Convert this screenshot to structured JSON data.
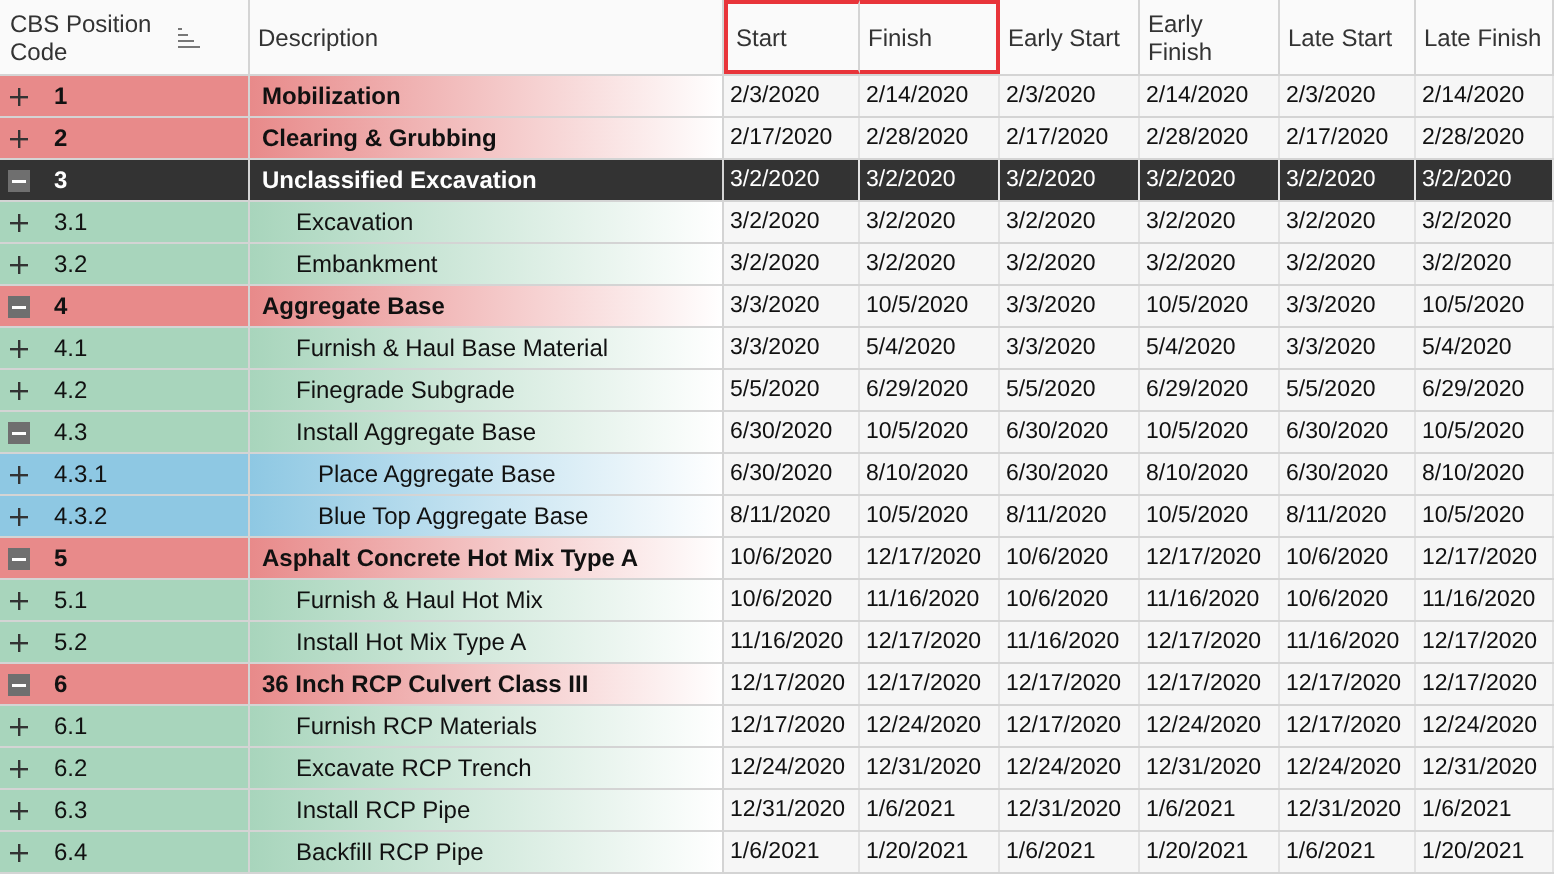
{
  "columns": [
    {
      "label": "CBS Position Code",
      "highlighted": false
    },
    {
      "label": "Description",
      "highlighted": false
    },
    {
      "label": "Start",
      "highlighted": true
    },
    {
      "label": "Finish",
      "highlighted": true
    },
    {
      "label": "Early Start",
      "highlighted": false
    },
    {
      "label": "Early Finish",
      "highlighted": false
    },
    {
      "label": "Late Start",
      "highlighted": false
    },
    {
      "label": "Late Finish",
      "highlighted": false
    }
  ],
  "rows": [
    {
      "code": "1",
      "description": "Mobilization",
      "expanded": false,
      "selected": false,
      "dates": [
        "2/3/2020",
        "2/14/2020",
        "2/3/2020",
        "2/14/2020",
        "2/3/2020",
        "2/14/2020"
      ]
    },
    {
      "code": "2",
      "description": "Clearing & Grubbing",
      "expanded": false,
      "selected": false,
      "dates": [
        "2/17/2020",
        "2/28/2020",
        "2/17/2020",
        "2/28/2020",
        "2/17/2020",
        "2/28/2020"
      ]
    },
    {
      "code": "3",
      "description": "Unclassified Excavation",
      "expanded": true,
      "selected": true,
      "dates": [
        "3/2/2020",
        "3/2/2020",
        "3/2/2020",
        "3/2/2020",
        "3/2/2020",
        "3/2/2020"
      ],
      "children": [
        {
          "code": "3.1",
          "description": "Excavation",
          "expanded": false,
          "selected": false,
          "dates": [
            "3/2/2020",
            "3/2/2020",
            "3/2/2020",
            "3/2/2020",
            "3/2/2020",
            "3/2/2020"
          ]
        },
        {
          "code": "3.2",
          "description": "Embankment",
          "expanded": false,
          "selected": false,
          "dates": [
            "3/2/2020",
            "3/2/2020",
            "3/2/2020",
            "3/2/2020",
            "3/2/2020",
            "3/2/2020"
          ]
        }
      ]
    },
    {
      "code": "4",
      "description": "Aggregate Base",
      "expanded": true,
      "selected": false,
      "dates": [
        "3/3/2020",
        "10/5/2020",
        "3/3/2020",
        "10/5/2020",
        "3/3/2020",
        "10/5/2020"
      ],
      "children": [
        {
          "code": "4.1",
          "description": "Furnish & Haul Base Material",
          "expanded": false,
          "selected": false,
          "dates": [
            "3/3/2020",
            "5/4/2020",
            "3/3/2020",
            "5/4/2020",
            "3/3/2020",
            "5/4/2020"
          ]
        },
        {
          "code": "4.2",
          "description": "Finegrade Subgrade",
          "expanded": false,
          "selected": false,
          "dates": [
            "5/5/2020",
            "6/29/2020",
            "5/5/2020",
            "6/29/2020",
            "5/5/2020",
            "6/29/2020"
          ]
        },
        {
          "code": "4.3",
          "description": "Install Aggregate Base",
          "expanded": true,
          "selected": false,
          "dates": [
            "6/30/2020",
            "10/5/2020",
            "6/30/2020",
            "10/5/2020",
            "6/30/2020",
            "10/5/2020"
          ],
          "children": [
            {
              "code": "4.3.1",
              "description": "Place Aggregate Base",
              "expanded": false,
              "selected": false,
              "dates": [
                "6/30/2020",
                "8/10/2020",
                "6/30/2020",
                "8/10/2020",
                "6/30/2020",
                "8/10/2020"
              ]
            },
            {
              "code": "4.3.2",
              "description": "Blue Top Aggregate Base",
              "expanded": false,
              "selected": false,
              "dates": [
                "8/11/2020",
                "10/5/2020",
                "8/11/2020",
                "10/5/2020",
                "8/11/2020",
                "10/5/2020"
              ]
            }
          ]
        }
      ]
    },
    {
      "code": "5",
      "description": "Asphalt Concrete Hot Mix Type A",
      "expanded": true,
      "selected": false,
      "dates": [
        "10/6/2020",
        "12/17/2020",
        "10/6/2020",
        "12/17/2020",
        "10/6/2020",
        "12/17/2020"
      ],
      "children": [
        {
          "code": "5.1",
          "description": "Furnish & Haul Hot Mix",
          "expanded": false,
          "selected": false,
          "dates": [
            "10/6/2020",
            "11/16/2020",
            "10/6/2020",
            "11/16/2020",
            "10/6/2020",
            "11/16/2020"
          ]
        },
        {
          "code": "5.2",
          "description": "Install Hot Mix Type A",
          "expanded": false,
          "selected": false,
          "dates": [
            "11/16/2020",
            "12/17/2020",
            "11/16/2020",
            "12/17/2020",
            "11/16/2020",
            "12/17/2020"
          ]
        }
      ]
    },
    {
      "code": "6",
      "description": "36 Inch RCP Culvert Class III",
      "expanded": true,
      "selected": false,
      "dates": [
        "12/17/2020",
        "12/17/2020",
        "12/17/2020",
        "12/17/2020",
        "12/17/2020",
        "12/17/2020"
      ],
      "children": [
        {
          "code": "6.1",
          "description": "Furnish RCP Materials",
          "expanded": false,
          "selected": false,
          "dates": [
            "12/17/2020",
            "12/24/2020",
            "12/17/2020",
            "12/24/2020",
            "12/17/2020",
            "12/24/2020"
          ]
        },
        {
          "code": "6.2",
          "description": "Excavate RCP Trench",
          "expanded": false,
          "selected": false,
          "dates": [
            "12/24/2020",
            "12/31/2020",
            "12/24/2020",
            "12/31/2020",
            "12/24/2020",
            "12/31/2020"
          ]
        },
        {
          "code": "6.3",
          "description": "Install RCP Pipe",
          "expanded": false,
          "selected": false,
          "dates": [
            "12/31/2020",
            "1/6/2021",
            "12/31/2020",
            "1/6/2021",
            "12/31/2020",
            "1/6/2021"
          ]
        },
        {
          "code": "6.4",
          "description": "Backfill RCP Pipe",
          "expanded": false,
          "selected": false,
          "dates": [
            "1/6/2021",
            "1/20/2021",
            "1/6/2021",
            "1/20/2021",
            "1/6/2021",
            "1/20/2021"
          ]
        }
      ]
    }
  ]
}
